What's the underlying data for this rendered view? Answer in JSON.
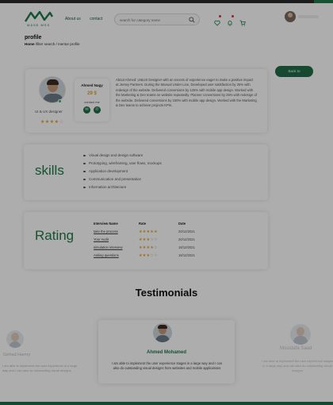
{
  "header": {
    "logo_tag": "MASE MSS",
    "nav": [
      "About us",
      "contact"
    ],
    "search_placeholder": "search for category name"
  },
  "page": {
    "title": "profile",
    "breadcrumb_home": "Home",
    "breadcrumb_rest": " /filter search / mentor profile"
  },
  "back_button": "Back to",
  "profile": {
    "designation": "UI & UX designer",
    "mini_name": "Ahmed Nagy",
    "mini_number": "29 $",
    "mini_label": "contact me",
    "about": "About Ahmed: UI&UX Designer with an excess of experience eager to make a positive impact at Jersey Partners. During the Manual Under Line, Developed user satisfaction by 25% with redesign of the website. Delivered conversions by 125% with mobile app design. Worked with the Marketing & Dev teams on website repeatedly. Planner conversions by 25% with redesign of the website. Delivered conversions by 150% with mobile app design. Worked with the Marketing & Dev teams to achieve projects KPIs.",
    "rating_stars": 4
  },
  "skills": {
    "title": "skills",
    "items": [
      "Visual design and design software",
      "Prototyping, wireframing, user flows, mockups",
      "Application development",
      "Communication and presentation",
      "Information architecture"
    ]
  },
  "rating": {
    "title": "Rating",
    "columns": [
      "Interview Name",
      "Rate",
      "Date"
    ],
    "rows": [
      {
        "name": "take the process",
        "stars": 5,
        "date": "20/12/2021"
      },
      {
        "name": "Your Audit",
        "stars": 3,
        "date": "20/12/2021"
      },
      {
        "name": "simulation interview",
        "stars": 4,
        "date": "16/12/2021"
      },
      {
        "name": "Asking questions",
        "stars": 3,
        "date": "16/12/2021"
      }
    ]
  },
  "testimonials": {
    "title": "Testimonials",
    "main": {
      "name": "Ahmed Mohamed",
      "text": "I am able to implement the user experience stages in a large way and I can also do outstanding visual designs from websites and mobile applications"
    },
    "left": {
      "name": "Gehad Hamry",
      "text": "I am able to implement the user experience in a large way and I can also do outstanding visual designs"
    },
    "right": {
      "name": "Moustafa Saad",
      "text": "I am able to implement the user experience stages in a large way and can also do outstanding visual designs"
    }
  },
  "colors": {
    "brand_green": "#1f7a4a",
    "star_gold": "#e0a526",
    "overlay": "rgba(0,0,0,0.32)"
  }
}
